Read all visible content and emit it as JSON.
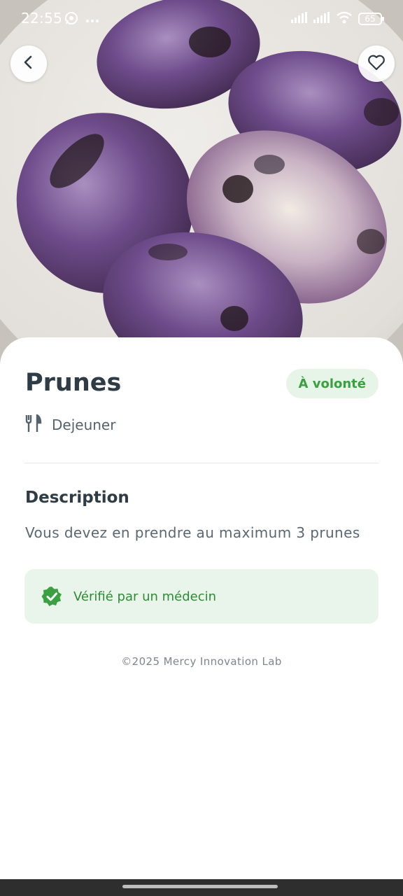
{
  "status_bar": {
    "time": "22:55",
    "battery": "65",
    "icons": [
      "whatsapp-icon",
      "more-dots-icon",
      "signal-icon",
      "signal-icon",
      "wifi-icon",
      "battery-icon"
    ]
  },
  "header": {
    "back_icon": "chevron-left-icon",
    "favorite_icon": "heart-outline-icon"
  },
  "food": {
    "name": "Prunes",
    "badge": "À volonté",
    "meal_icon": "fork-knife-icon",
    "meal": "Dejeuner"
  },
  "description": {
    "heading": "Description",
    "text": "Vous devez en prendre au maximum 3 prunes"
  },
  "verification": {
    "icon": "verified-badge-icon",
    "label": "Vérifié par un médecin"
  },
  "footer": {
    "text": "©2025 Mercy Innovation Lab"
  },
  "colors": {
    "accent_green": "#3aa041",
    "badge_bg": "#e7f4e8",
    "title": "#2f3b45",
    "text_muted": "#5a6872"
  }
}
